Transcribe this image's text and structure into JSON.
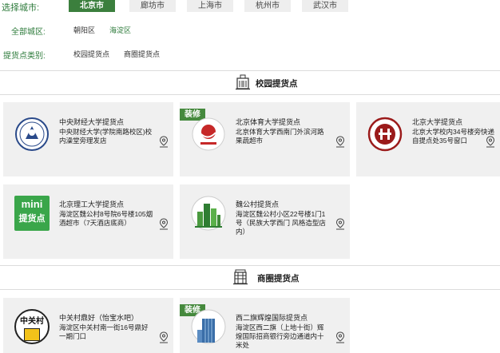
{
  "filters": {
    "city": {
      "label": "选择城市:",
      "options": [
        "北京市",
        "廊坊市",
        "上海市",
        "杭州市",
        "武汉市"
      ],
      "selected": "北京市"
    },
    "district": {
      "label": "全部城区:",
      "options": [
        "朝阳区",
        "海淀区"
      ],
      "selected": "海淀区"
    },
    "category": {
      "label": "提货点类别:",
      "options": [
        "校园提货点",
        "商圈提货点"
      ]
    }
  },
  "sections": [
    {
      "title": "校园提货点",
      "icon": "school-building-icon",
      "cards": [
        {
          "name": "中央财经大学提货点",
          "address": "中央财经大学(学院南路校区)校内澡堂旁理发店",
          "logo": "cufe-emblem",
          "badge": ""
        },
        {
          "name": "北京体育大学提货点",
          "address": "北京体育大学西南门外滨河路果蔬超市",
          "logo": "bsu-emblem",
          "badge": "装修"
        },
        {
          "name": "北京大学提货点",
          "address": "北京大学校内34号楼旁快递自提点处35号窗口",
          "logo": "pku-emblem",
          "badge": ""
        },
        {
          "name": "北京理工大学提货点",
          "address": "海淀区魏公村8号院6号楼105烟酒超市（7天酒店底商）",
          "logo": "mini-logo",
          "logo_text_1": "mini",
          "logo_text_2": "提货点",
          "badge": ""
        },
        {
          "name": "魏公村提货点",
          "address": "海淀区魏公村小区22号楼1门1号（民族大学西门 风格造型店内）",
          "logo": "city-buildings-logo",
          "badge": ""
        }
      ]
    },
    {
      "title": "商圈提货点",
      "icon": "mall-building-icon",
      "cards": [
        {
          "name": "中关村鼎好（怡宝水吧）",
          "address": "海淀区中关村南一街16号鼎好一期门口",
          "logo": "zhongguancun-logo",
          "logo_text_1": "中关村",
          "badge": ""
        },
        {
          "name": "西二旗辉煌国际提货点",
          "address": "海淀区西二旗（上地十街）辉煌国际招商银行旁边通道内十米处",
          "logo": "tower-logo",
          "badge": "装修"
        }
      ]
    }
  ],
  "colors": {
    "accent": "#3b7f3d",
    "label_green": "#2c7a3a",
    "card_bg": "#f0f0f0",
    "badge": "#45893d"
  }
}
